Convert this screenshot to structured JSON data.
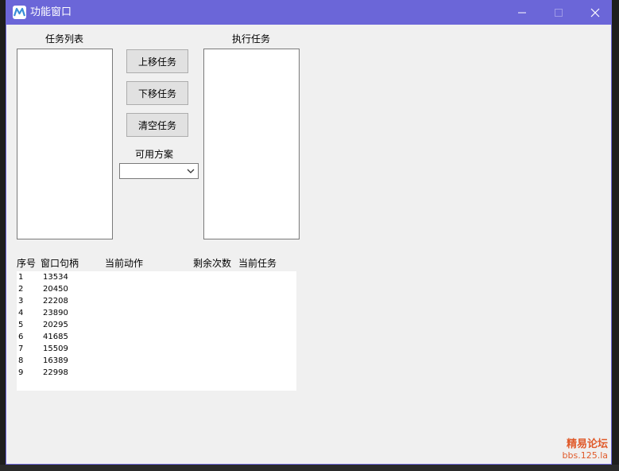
{
  "window": {
    "title": "功能窗口",
    "accent": "#6b66d8"
  },
  "labels": {
    "task_list": "任务列表",
    "exec_tasks": "执行任务",
    "available_plans": "可用方案"
  },
  "buttons": {
    "move_up": "上移任务",
    "move_down": "下移任务",
    "clear": "清空任务"
  },
  "combo": {
    "selected": ""
  },
  "grid": {
    "columns": [
      "序号",
      "窗口句柄",
      "当前动作",
      "剩余次数",
      "当前任务"
    ],
    "rows": [
      {
        "index": "1",
        "handle": "13534"
      },
      {
        "index": "2",
        "handle": "20450"
      },
      {
        "index": "3",
        "handle": "22208"
      },
      {
        "index": "4",
        "handle": "23890"
      },
      {
        "index": "5",
        "handle": "20295"
      },
      {
        "index": "6",
        "handle": "41685"
      },
      {
        "index": "7",
        "handle": "15509"
      },
      {
        "index": "8",
        "handle": "16389"
      },
      {
        "index": "9",
        "handle": "22998"
      }
    ]
  },
  "watermark": {
    "line1": "精易论坛",
    "line2": "bbs.125.la"
  }
}
